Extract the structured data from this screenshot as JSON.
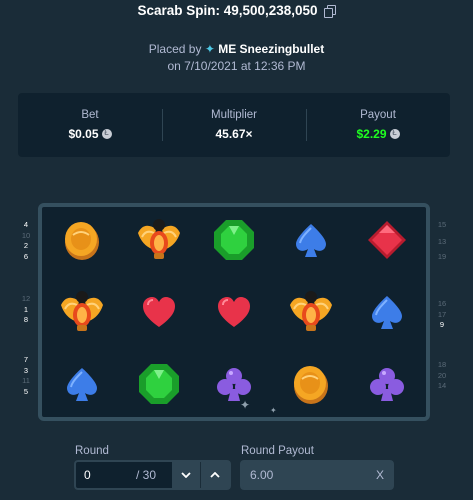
{
  "header": {
    "title": "Scarab Spin: 49,500,238,050",
    "copy_icon": "copy-icon",
    "placed_by_prefix": "Placed by",
    "user": "ME Sneezingbullet",
    "user_icon": "star-icon",
    "date": "on 7/10/2021 at 12:36 PM"
  },
  "stats": {
    "bet_label": "Bet",
    "bet_value": "$0.05",
    "multiplier_label": "Multiplier",
    "multiplier_value": "45.67×",
    "payout_label": "Payout",
    "payout_value": "$2.29",
    "payout_color": "#1fff20",
    "coin_icon": "coin-icon"
  },
  "paylines": {
    "left_top": [
      "4",
      "10",
      "2",
      "6"
    ],
    "left_mid": [
      "12",
      "1",
      "8"
    ],
    "left_bot": [
      "7",
      "3",
      "11",
      "5"
    ],
    "right_top": [
      "15",
      "13",
      "19"
    ],
    "right_mid": [
      "16",
      "17",
      "9"
    ],
    "right_bot": [
      "18",
      "20",
      "14"
    ]
  },
  "reels": [
    [
      "coin",
      "scarab",
      "spade"
    ],
    [
      "scarab",
      "heart",
      "gem"
    ],
    [
      "gem",
      "heart",
      "club"
    ],
    [
      "spade",
      "scarab",
      "coin"
    ],
    [
      "diamond",
      "spade",
      "club"
    ]
  ],
  "controls": {
    "round_label": "Round",
    "round_value": "0",
    "round_total": "/ 30",
    "down_icon": "chevron-down-icon",
    "up_icon": "chevron-up-icon",
    "payout_label": "Round Payout",
    "payout_value": "6.00",
    "clear_label": "X"
  }
}
